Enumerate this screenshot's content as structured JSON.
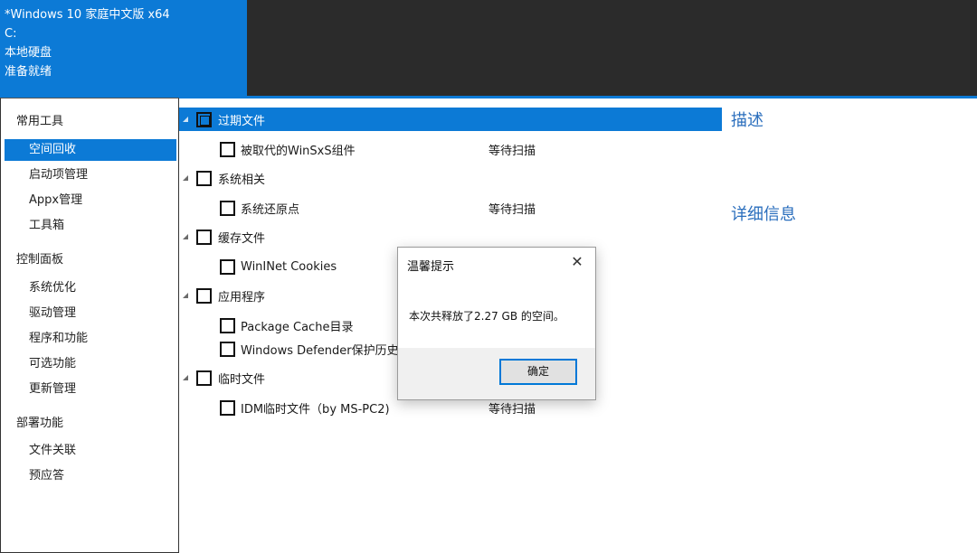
{
  "sysinfo": {
    "os": "*Windows 10 家庭中文版 x64",
    "drive": "C:",
    "disk": "本地硬盘",
    "status": "准备就绪"
  },
  "sidebar": {
    "groups": [
      {
        "header": "常用工具",
        "items": [
          "空间回收",
          "启动项管理",
          "Appx管理",
          "工具箱"
        ]
      },
      {
        "header": "控制面板",
        "items": [
          "系统优化",
          "驱动管理",
          "程序和功能",
          "可选功能",
          "更新管理"
        ]
      },
      {
        "header": "部署功能",
        "items": [
          "文件关联",
          "预应答"
        ]
      }
    ],
    "selected": "空间回收"
  },
  "tree": {
    "categories": [
      {
        "label": "过期文件",
        "children": [
          {
            "label": "被取代的WinSxS组件",
            "status": "等待扫描"
          }
        ]
      },
      {
        "label": "系统相关",
        "children": [
          {
            "label": "系统还原点",
            "status": "等待扫描"
          }
        ]
      },
      {
        "label": "缓存文件",
        "children": [
          {
            "label": "WinINet Cookies",
            "status": ""
          }
        ]
      },
      {
        "label": "应用程序",
        "children": [
          {
            "label": "Package Cache目录",
            "status": ""
          },
          {
            "label": "Windows Defender保护历史",
            "status": ""
          }
        ]
      },
      {
        "label": "临时文件",
        "children": [
          {
            "label": "IDM临时文件（by MS-PC2)",
            "status": "等待扫描"
          }
        ]
      }
    ]
  },
  "details": {
    "description_title": "描述",
    "detail_title": "详细信息"
  },
  "dialog": {
    "title": "温馨提示",
    "message": "本次共释放了2.27 GB 的空间。",
    "ok_label": "确定",
    "close_glyph": "✕"
  },
  "colors": {
    "accent": "#0c7ad6",
    "topbar": "#2b2b2b",
    "heading": "#2a6ebd"
  }
}
